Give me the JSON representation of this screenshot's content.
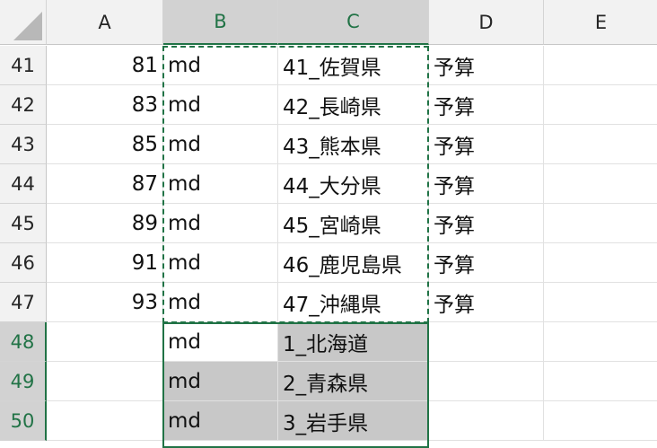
{
  "columns": [
    "A",
    "B",
    "C",
    "D",
    "E"
  ],
  "rows": [
    {
      "num": "41",
      "a": "81",
      "b": "md",
      "c": "41_佐賀県",
      "d": "予算"
    },
    {
      "num": "42",
      "a": "83",
      "b": "md",
      "c": "42_長崎県",
      "d": "予算"
    },
    {
      "num": "43",
      "a": "85",
      "b": "md",
      "c": "43_熊本県",
      "d": "予算"
    },
    {
      "num": "44",
      "a": "87",
      "b": "md",
      "c": "44_大分県",
      "d": "予算"
    },
    {
      "num": "45",
      "a": "89",
      "b": "md",
      "c": "45_宮崎県",
      "d": "予算"
    },
    {
      "num": "46",
      "a": "91",
      "b": "md",
      "c": "46_鹿児島県",
      "d": "予算"
    },
    {
      "num": "47",
      "a": "93",
      "b": "md",
      "c": "47_沖縄県",
      "d": "予算"
    },
    {
      "num": "48",
      "a": "",
      "b": "md",
      "c": "1_北海道",
      "d": ""
    },
    {
      "num": "49",
      "a": "",
      "b": "md",
      "c": "2_青森県",
      "d": ""
    },
    {
      "num": "50",
      "a": "",
      "b": "md",
      "c": "3_岩手県",
      "d": ""
    }
  ],
  "colors": {
    "accent": "#217346",
    "selection_fill": "#c8c8c8",
    "header_bg": "#f2f2f2"
  }
}
